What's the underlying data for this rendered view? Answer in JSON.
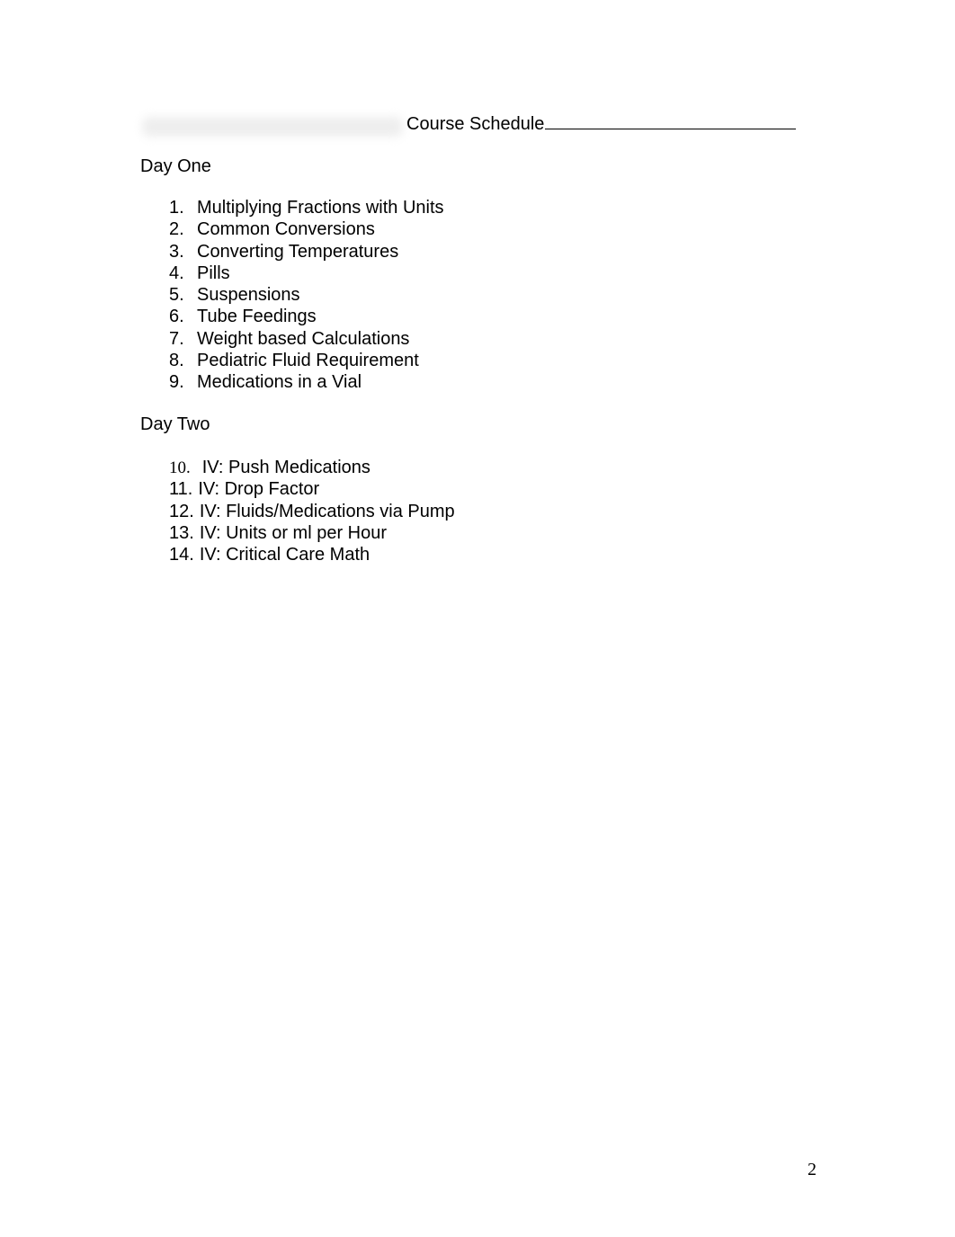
{
  "document": {
    "title": "Course Schedule",
    "sections": [
      {
        "heading": "Day One",
        "items": [
          {
            "number": "1.",
            "text": "Multiplying Fractions with Units"
          },
          {
            "number": "2.",
            "text": "Common Conversions"
          },
          {
            "number": "3.",
            "text": "Converting Temperatures"
          },
          {
            "number": "4.",
            "text": "Pills"
          },
          {
            "number": "5.",
            "text": "Suspensions"
          },
          {
            "number": "6.",
            "text": "Tube Feedings"
          },
          {
            "number": "7.",
            "text": "Weight based Calculations"
          },
          {
            "number": "8.",
            "text": "Pediatric Fluid Requirement"
          },
          {
            "number": "9.",
            "text": "Medications in a Vial"
          }
        ]
      },
      {
        "heading": "Day Two",
        "items": [
          {
            "number": "10.",
            "text": "IV: Push Medications"
          },
          {
            "number": "11.",
            "text": "IV: Drop Factor"
          },
          {
            "number": "12.",
            "text": "IV: Fluids/Medications via Pump"
          },
          {
            "number": "13.",
            "text": "IV: Units or ml per Hour"
          },
          {
            "number": "14.",
            "text": "IV: Critical Care Math"
          }
        ]
      }
    ],
    "page_number": "2"
  }
}
